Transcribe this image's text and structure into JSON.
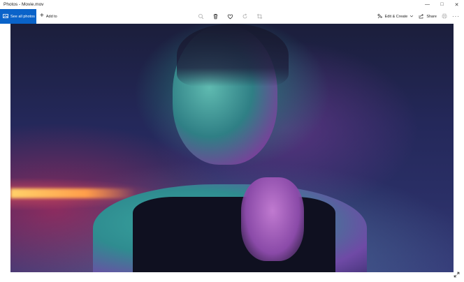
{
  "window": {
    "title": "Photos - Movie.mov",
    "minimize_icon": "minimize-icon",
    "maximize_icon": "maximize-icon",
    "close_icon": "close-icon"
  },
  "toolbar": {
    "see_all_label": "See all photos",
    "add_to_label": "Add to",
    "center_icons": [
      "zoom-icon",
      "delete-icon",
      "favorite-icon",
      "rotate-icon",
      "crop-icon"
    ],
    "edit_create_label": "Edit & Create",
    "share_label": "Share",
    "print_icon": "print-icon",
    "more_label": "···"
  },
  "colors": {
    "accent": "#0a63c9"
  }
}
